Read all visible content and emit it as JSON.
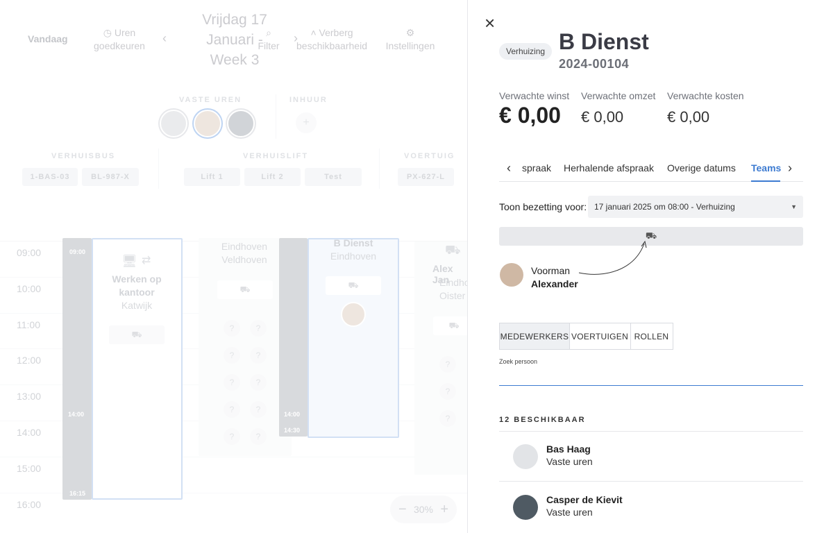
{
  "toolbar": {
    "today": "Vandaag",
    "approve_line1": "Uren",
    "approve_line2": "goedkeuren",
    "day_line1": "Vrijdag 17",
    "day_line2": "Januari -",
    "day_line3": "Week 3",
    "filter": "Filter",
    "hide_line1": "Verberg",
    "hide_line2": "beschikbaarheid",
    "settings": "Instellingen"
  },
  "staff": {
    "fixed_label": "VASTE UREN",
    "hire_label": "INHUUR"
  },
  "resources": {
    "bus_label": "VERHUISBUS",
    "lift_label": "VERHUISLIFT",
    "vehicle_label": "VOERTUIG",
    "bus": [
      "1-BAS-03",
      "BL-987-X"
    ],
    "lift": [
      "Lift 1",
      "Lift 2",
      "Test"
    ],
    "vehicle": [
      "PX-627-L"
    ]
  },
  "times": [
    "09:00",
    "10:00",
    "11:00",
    "12:00",
    "13:00",
    "14:00",
    "15:00",
    "16:00"
  ],
  "calendar": {
    "c1_start": "09:00",
    "c1_mid": "14:00",
    "c1_end": "16:15",
    "c1_title": "Werken op kantoor",
    "c1_place": "Katwijk",
    "c2_line1": "Eindhoven",
    "c2_line2": "Veldhoven",
    "c3_mid": "14:00",
    "c3_end": "14:30",
    "c3_title": "B Dienst",
    "c3_place": "Eindhoven",
    "c4_name": "Alex Jan",
    "c4_line1": "Eindho",
    "c4_line2": "Oister"
  },
  "zoom": {
    "value": "30%",
    "minus": "−",
    "plus": "+"
  },
  "panel": {
    "close": "×",
    "badge": "Verhuizing",
    "title": "B Dienst",
    "number": "2024-00104",
    "metrics": [
      {
        "label": "Verwachte winst",
        "value": "€ 0,00"
      },
      {
        "label": "Verwachte omzet",
        "value": "€ 0,00"
      },
      {
        "label": "Verwachte kosten",
        "value": "€ 0,00"
      }
    ],
    "tabs": [
      "spraak",
      "Herhalende afspraak",
      "Overige datums",
      "Teams"
    ],
    "active_tab": "Teams",
    "occupancy_label": "Toon bezetting voor:",
    "occupancy_value": "17 januari 2025 om 08:00 - Verhuizing",
    "foreman_role": "Voorman",
    "foreman_name": "Alexander",
    "segments": [
      "MEDEWERKERS",
      "VOERTUIGEN",
      "ROLLEN"
    ],
    "search_label": "Zoek persoon",
    "available_header": "12 BESCHIKBAAR",
    "people": [
      {
        "name": "Bas Haag",
        "type": "Vaste uren"
      },
      {
        "name": "Casper de Kievit",
        "type": "Vaste uren"
      }
    ]
  },
  "colors": {
    "accent": "#3d7bd1",
    "event_gray": "#b0b4ba",
    "event_blue": "#3d7bd1"
  }
}
